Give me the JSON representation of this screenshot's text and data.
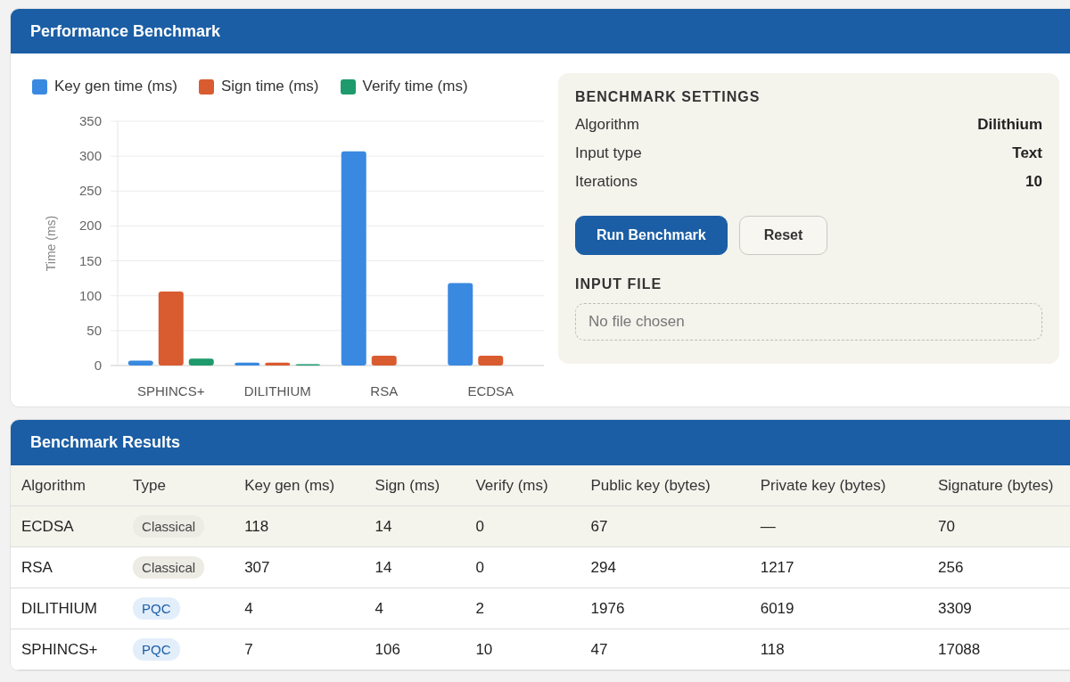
{
  "benchmark_panel": {
    "title": "Performance Benchmark",
    "chart_data": {
      "type": "bar",
      "grid": true,
      "ylabel": "Time (ms)",
      "categories": [
        "SPHINCS+",
        "DILITHIUM",
        "RSA",
        "ECDSA"
      ],
      "ylim": [
        0,
        350
      ],
      "yticks": [
        0,
        50,
        100,
        150,
        200,
        250,
        300,
        350
      ],
      "series": [
        {
          "name": "Key gen time (ms)",
          "color": "#3a89e0",
          "values": [
            7,
            4,
            307,
            118
          ]
        },
        {
          "name": "Sign time (ms)",
          "color": "#d95b30",
          "values": [
            106,
            4,
            14,
            14
          ]
        },
        {
          "name": "Verify time (ms)",
          "color": "#1e9a6c",
          "values": [
            10,
            2,
            0,
            0
          ]
        }
      ]
    },
    "settings": {
      "heading": "BENCHMARK SETTINGS",
      "rows": [
        {
          "label": "Algorithm",
          "value": "Dilithium"
        },
        {
          "label": "Input type",
          "value": "Text"
        },
        {
          "label": "Iterations",
          "value": "10"
        }
      ],
      "buttons": [
        {
          "label": "Run Benchmark",
          "kind": "primary"
        },
        {
          "label": "Reset",
          "kind": "secondary"
        }
      ],
      "file_heading": "INPUT FILE",
      "file_placeholder": "No file chosen"
    }
  },
  "results_panel": {
    "title": "Benchmark Results",
    "columns": [
      "Algorithm",
      "Type",
      "Key gen (ms)",
      "Sign (ms)",
      "Verify (ms)",
      "Public key (bytes)",
      "Private key (bytes)",
      "Signature (bytes)"
    ],
    "rows": [
      {
        "selected": true,
        "kind": "classical",
        "cells": [
          "ECDSA",
          "Classical",
          "118",
          "14",
          "0",
          "67",
          "—",
          "70"
        ]
      },
      {
        "selected": false,
        "kind": "classical",
        "cells": [
          "RSA",
          "Classical",
          "307",
          "14",
          "0",
          "294",
          "1217",
          "256"
        ]
      },
      {
        "selected": false,
        "kind": "pqc",
        "cells": [
          "DILITHIUM",
          "PQC",
          "4",
          "4",
          "2",
          "1976",
          "6019",
          "3309"
        ]
      },
      {
        "selected": false,
        "kind": "pqc",
        "cells": [
          "SPHINCS+",
          "PQC",
          "7",
          "106",
          "10",
          "47",
          "118",
          "17088"
        ]
      }
    ]
  }
}
